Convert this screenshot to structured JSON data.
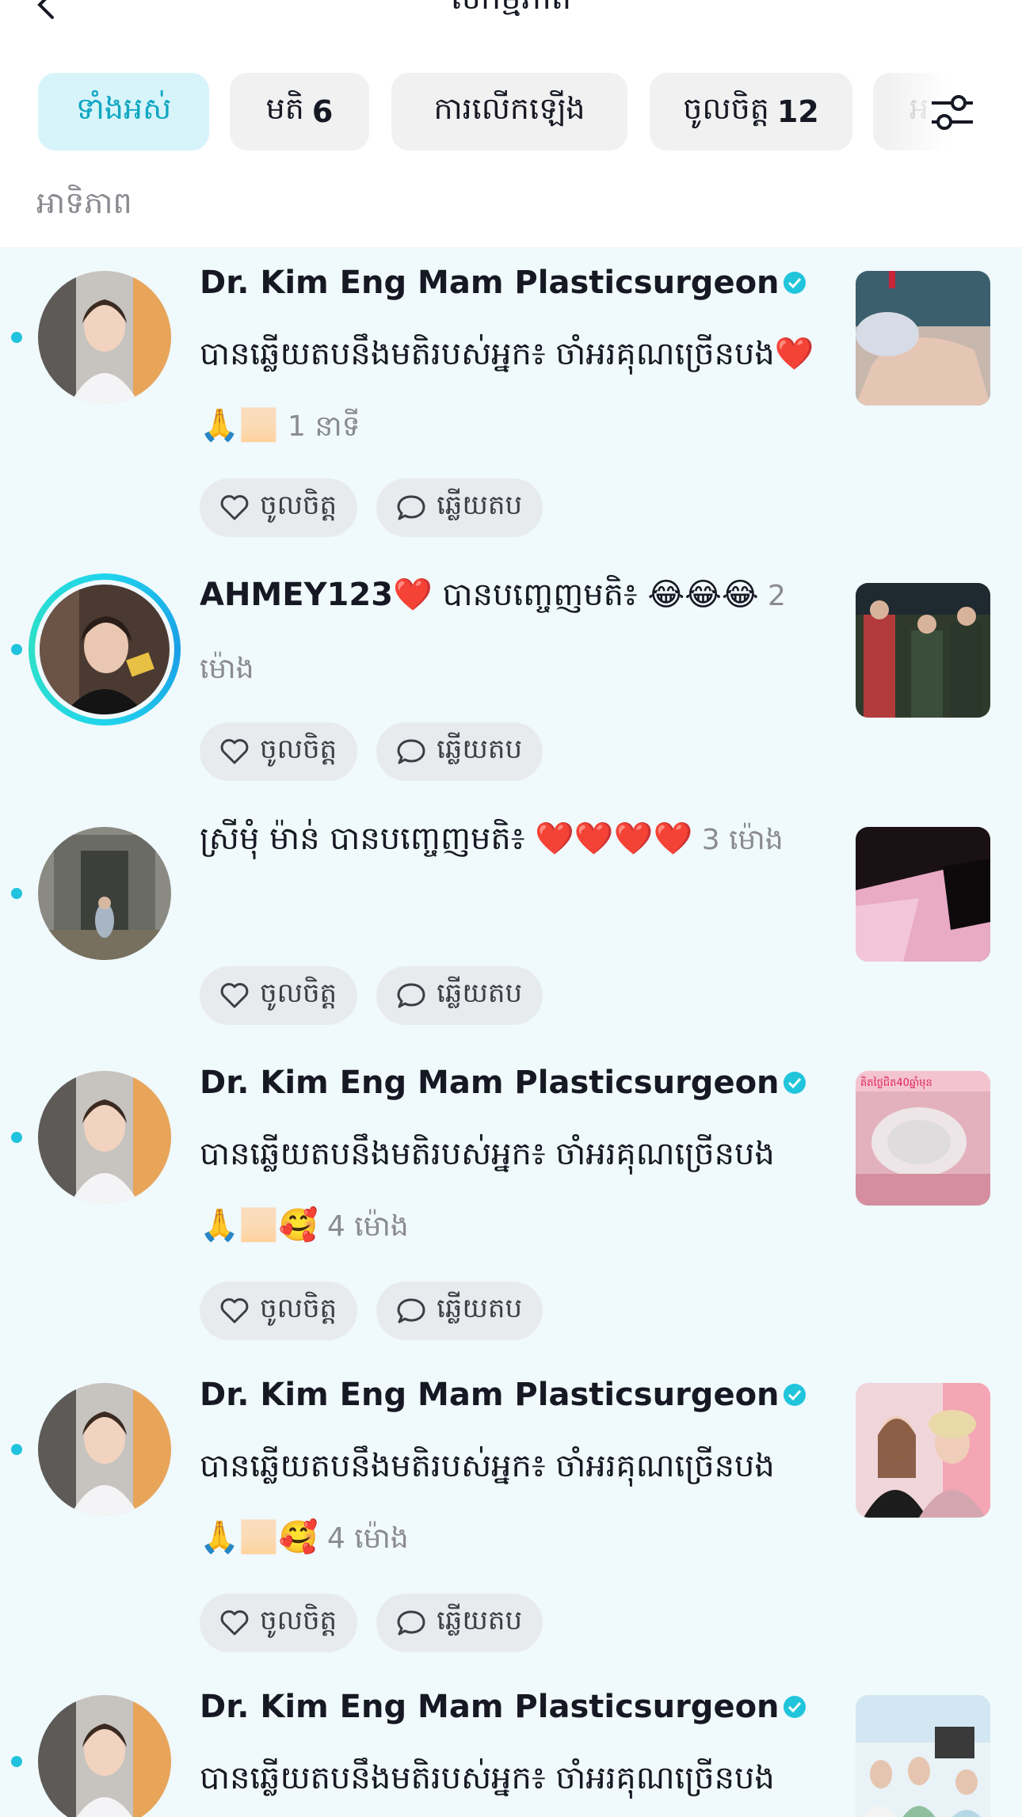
{
  "header": {
    "title": "សកម្មភាព"
  },
  "tabs": [
    {
      "label": "ទាំងអស់",
      "count": ""
    },
    {
      "label": "មតិ",
      "count": "6"
    },
    {
      "label": "ការលើកឡើង",
      "count": ""
    },
    {
      "label": "ចូលចិត្ត",
      "count": "12"
    },
    {
      "label": "អ",
      "count": ""
    }
  ],
  "section": {
    "label": "អាទិភាព"
  },
  "actions": {
    "like": "ចូលចិត្ត",
    "reply": "ឆ្លើយតប"
  },
  "notifications": [
    {
      "name": "Dr. Kim Eng Mam Plasticsurgeon",
      "message": " បានឆ្លើយតបនឹងមតិរបស់អ្នក៖ ចាំអរគុណច្រើនបង❤️🙏🏻",
      "time": " 1 នាទី"
    },
    {
      "name": "AHMEY123❤️",
      "message": " បានបញ្ចេញមតិ៖ 😂😂😂",
      "time": " 2 ម៉ោង"
    },
    {
      "name": "ស្រីមុំ ម៉ាន់",
      "message": " បានបញ្ចេញមតិ៖ ❤️❤️❤️❤️",
      "time": " 3 ម៉ោង"
    },
    {
      "name": "Dr. Kim Eng Mam Plasticsurgeon",
      "message": " បានឆ្លើយតបនឹងមតិរបស់អ្នក៖ ចាំអរគុណច្រើនបង🙏🏻🥰",
      "time": " 4 ម៉ោង"
    },
    {
      "name": "Dr. Kim Eng Mam Plasticsurgeon",
      "message": " បានឆ្លើយតបនឹងមតិរបស់អ្នក៖ ចាំអរគុណច្រើនបង🙏🏻🥰",
      "time": " 4 ម៉ោង"
    },
    {
      "name": "Dr. Kim Eng Mam Plasticsurgeon",
      "message": " បានឆ្លើយតបនឹងមតិរបស់អ្នក៖ ចាំអរគុណច្រើនបង🙏🏻",
      "time": ""
    }
  ],
  "thumbnail_captions": {
    "item4": "គិតថ្លៃជិត40ឆ្នាំមុន"
  },
  "colors": {
    "accent": "#20c5dc",
    "active_chip_bg": "#d7f4fb",
    "feed_bg": "#f0f9fc",
    "unread_dot": "#21c2dd"
  },
  "icons": {
    "back": "chevron-left-icon",
    "filter": "sliders-icon",
    "like": "heart-outline-icon",
    "reply": "speech-bubble-icon",
    "verified": "verified-badge-icon"
  }
}
